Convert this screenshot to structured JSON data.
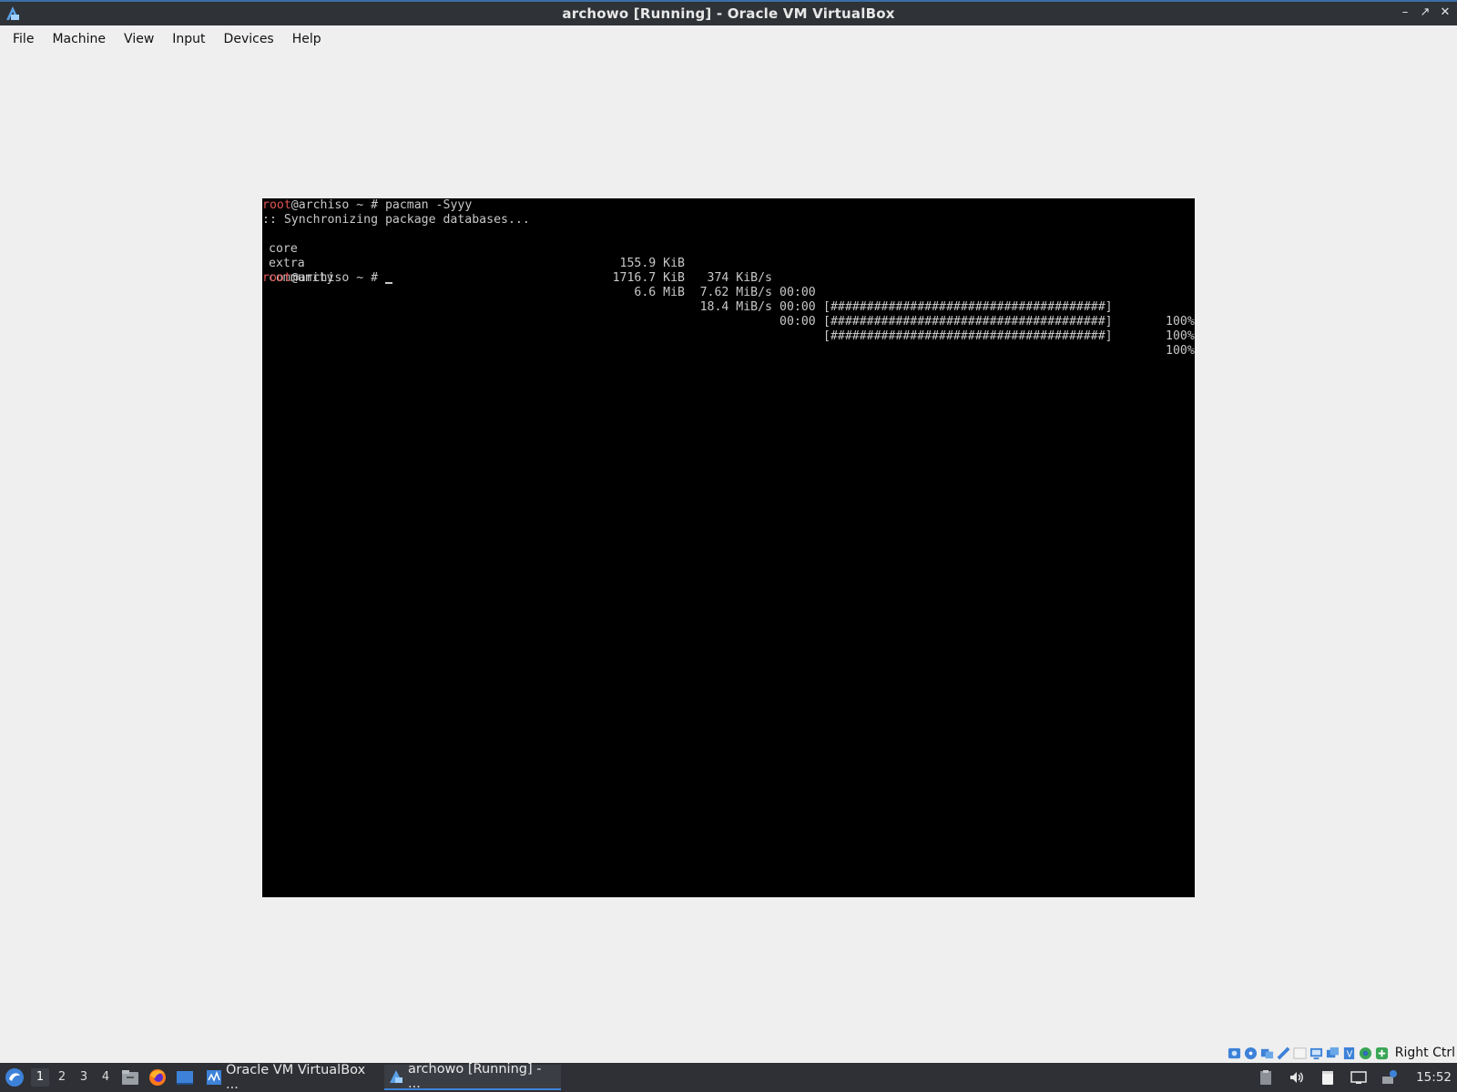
{
  "window": {
    "title": "archowo [Running] - Oracle VM VirtualBox",
    "controls": [
      "minimize",
      "maximize",
      "close"
    ]
  },
  "menubar": {
    "items": [
      "File",
      "Machine",
      "View",
      "Input",
      "Devices",
      "Help"
    ]
  },
  "terminal": {
    "prompt_user": "root",
    "prompt_rest": "@archiso ~ # ",
    "command": "pacman -Syyy",
    "sync_message": ":: Synchronizing package databases...",
    "databases": [
      {
        "name": "core",
        "size": "155.9 KiB",
        "rate": "374 KiB/s",
        "time": "00:00",
        "bar": "[######################################]",
        "percent": "100%"
      },
      {
        "name": "extra",
        "size": "1716.7 KiB",
        "rate": "7.62 MiB/s",
        "time": "00:00",
        "bar": "[######################################]",
        "percent": "100%"
      },
      {
        "name": "community",
        "size": "6.6 MiB",
        "rate": "18.4 MiB/s",
        "time": "00:00",
        "bar": "[######################################]",
        "percent": "100%"
      }
    ]
  },
  "vbox_status": {
    "icons": [
      "hard-disk-icon",
      "optical-drive-icon",
      "audio-icon",
      "network-icon",
      "usb-icon",
      "shared-folders-icon",
      "display-icon",
      "video-capture-icon",
      "mouse-integration-icon",
      "guest-additions-icon",
      "keyboard-icon"
    ],
    "host_key": "Right Ctrl"
  },
  "taskbar": {
    "workspaces": [
      "1",
      "2",
      "3",
      "4"
    ],
    "active_workspace": "1",
    "launchers": [
      "file-manager-icon",
      "firefox-icon",
      "desktop-icon"
    ],
    "tasks": [
      {
        "label": "Oracle VM VirtualBox ...",
        "icon": "virtualbox-manager-icon",
        "active": false
      },
      {
        "label": "archowo [Running] - ...",
        "icon": "virtualbox-vm-icon",
        "active": true
      }
    ],
    "tray": [
      "clipboard-icon",
      "volume-icon",
      "notes-icon",
      "network-tray-icon",
      "update-icon"
    ],
    "clock": "15:52"
  },
  "colors": {
    "titlebar": "#2f3237",
    "taskbar": "#2e3035",
    "prompt_red": "#e05555",
    "terminal_text": "#c8c8c8",
    "accent": "#3d82d8"
  }
}
